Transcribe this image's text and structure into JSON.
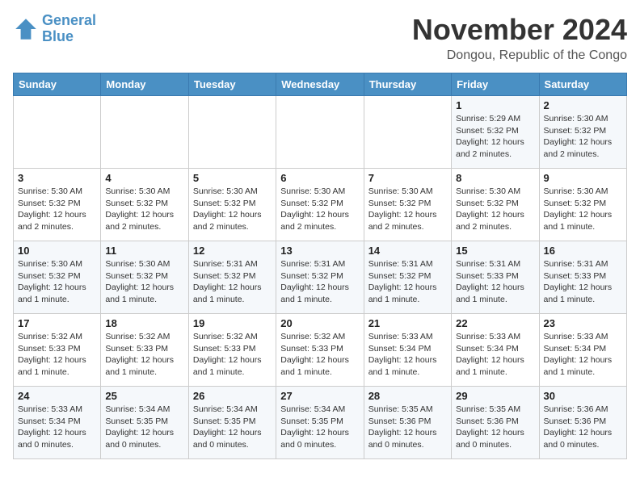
{
  "logo": {
    "line1": "General",
    "line2": "Blue"
  },
  "title": "November 2024",
  "location": "Dongou, Republic of the Congo",
  "days_header": [
    "Sunday",
    "Monday",
    "Tuesday",
    "Wednesday",
    "Thursday",
    "Friday",
    "Saturday"
  ],
  "weeks": [
    [
      {
        "day": "",
        "sunrise": "",
        "sunset": "",
        "daylight": ""
      },
      {
        "day": "",
        "sunrise": "",
        "sunset": "",
        "daylight": ""
      },
      {
        "day": "",
        "sunrise": "",
        "sunset": "",
        "daylight": ""
      },
      {
        "day": "",
        "sunrise": "",
        "sunset": "",
        "daylight": ""
      },
      {
        "day": "",
        "sunrise": "",
        "sunset": "",
        "daylight": ""
      },
      {
        "day": "1",
        "sunrise": "Sunrise: 5:29 AM",
        "sunset": "Sunset: 5:32 PM",
        "daylight": "Daylight: 12 hours and 2 minutes."
      },
      {
        "day": "2",
        "sunrise": "Sunrise: 5:30 AM",
        "sunset": "Sunset: 5:32 PM",
        "daylight": "Daylight: 12 hours and 2 minutes."
      }
    ],
    [
      {
        "day": "3",
        "sunrise": "Sunrise: 5:30 AM",
        "sunset": "Sunset: 5:32 PM",
        "daylight": "Daylight: 12 hours and 2 minutes."
      },
      {
        "day": "4",
        "sunrise": "Sunrise: 5:30 AM",
        "sunset": "Sunset: 5:32 PM",
        "daylight": "Daylight: 12 hours and 2 minutes."
      },
      {
        "day": "5",
        "sunrise": "Sunrise: 5:30 AM",
        "sunset": "Sunset: 5:32 PM",
        "daylight": "Daylight: 12 hours and 2 minutes."
      },
      {
        "day": "6",
        "sunrise": "Sunrise: 5:30 AM",
        "sunset": "Sunset: 5:32 PM",
        "daylight": "Daylight: 12 hours and 2 minutes."
      },
      {
        "day": "7",
        "sunrise": "Sunrise: 5:30 AM",
        "sunset": "Sunset: 5:32 PM",
        "daylight": "Daylight: 12 hours and 2 minutes."
      },
      {
        "day": "8",
        "sunrise": "Sunrise: 5:30 AM",
        "sunset": "Sunset: 5:32 PM",
        "daylight": "Daylight: 12 hours and 2 minutes."
      },
      {
        "day": "9",
        "sunrise": "Sunrise: 5:30 AM",
        "sunset": "Sunset: 5:32 PM",
        "daylight": "Daylight: 12 hours and 1 minute."
      }
    ],
    [
      {
        "day": "10",
        "sunrise": "Sunrise: 5:30 AM",
        "sunset": "Sunset: 5:32 PM",
        "daylight": "Daylight: 12 hours and 1 minute."
      },
      {
        "day": "11",
        "sunrise": "Sunrise: 5:30 AM",
        "sunset": "Sunset: 5:32 PM",
        "daylight": "Daylight: 12 hours and 1 minute."
      },
      {
        "day": "12",
        "sunrise": "Sunrise: 5:31 AM",
        "sunset": "Sunset: 5:32 PM",
        "daylight": "Daylight: 12 hours and 1 minute."
      },
      {
        "day": "13",
        "sunrise": "Sunrise: 5:31 AM",
        "sunset": "Sunset: 5:32 PM",
        "daylight": "Daylight: 12 hours and 1 minute."
      },
      {
        "day": "14",
        "sunrise": "Sunrise: 5:31 AM",
        "sunset": "Sunset: 5:32 PM",
        "daylight": "Daylight: 12 hours and 1 minute."
      },
      {
        "day": "15",
        "sunrise": "Sunrise: 5:31 AM",
        "sunset": "Sunset: 5:33 PM",
        "daylight": "Daylight: 12 hours and 1 minute."
      },
      {
        "day": "16",
        "sunrise": "Sunrise: 5:31 AM",
        "sunset": "Sunset: 5:33 PM",
        "daylight": "Daylight: 12 hours and 1 minute."
      }
    ],
    [
      {
        "day": "17",
        "sunrise": "Sunrise: 5:32 AM",
        "sunset": "Sunset: 5:33 PM",
        "daylight": "Daylight: 12 hours and 1 minute."
      },
      {
        "day": "18",
        "sunrise": "Sunrise: 5:32 AM",
        "sunset": "Sunset: 5:33 PM",
        "daylight": "Daylight: 12 hours and 1 minute."
      },
      {
        "day": "19",
        "sunrise": "Sunrise: 5:32 AM",
        "sunset": "Sunset: 5:33 PM",
        "daylight": "Daylight: 12 hours and 1 minute."
      },
      {
        "day": "20",
        "sunrise": "Sunrise: 5:32 AM",
        "sunset": "Sunset: 5:33 PM",
        "daylight": "Daylight: 12 hours and 1 minute."
      },
      {
        "day": "21",
        "sunrise": "Sunrise: 5:33 AM",
        "sunset": "Sunset: 5:34 PM",
        "daylight": "Daylight: 12 hours and 1 minute."
      },
      {
        "day": "22",
        "sunrise": "Sunrise: 5:33 AM",
        "sunset": "Sunset: 5:34 PM",
        "daylight": "Daylight: 12 hours and 1 minute."
      },
      {
        "day": "23",
        "sunrise": "Sunrise: 5:33 AM",
        "sunset": "Sunset: 5:34 PM",
        "daylight": "Daylight: 12 hours and 1 minute."
      }
    ],
    [
      {
        "day": "24",
        "sunrise": "Sunrise: 5:33 AM",
        "sunset": "Sunset: 5:34 PM",
        "daylight": "Daylight: 12 hours and 0 minutes."
      },
      {
        "day": "25",
        "sunrise": "Sunrise: 5:34 AM",
        "sunset": "Sunset: 5:35 PM",
        "daylight": "Daylight: 12 hours and 0 minutes."
      },
      {
        "day": "26",
        "sunrise": "Sunrise: 5:34 AM",
        "sunset": "Sunset: 5:35 PM",
        "daylight": "Daylight: 12 hours and 0 minutes."
      },
      {
        "day": "27",
        "sunrise": "Sunrise: 5:34 AM",
        "sunset": "Sunset: 5:35 PM",
        "daylight": "Daylight: 12 hours and 0 minutes."
      },
      {
        "day": "28",
        "sunrise": "Sunrise: 5:35 AM",
        "sunset": "Sunset: 5:36 PM",
        "daylight": "Daylight: 12 hours and 0 minutes."
      },
      {
        "day": "29",
        "sunrise": "Sunrise: 5:35 AM",
        "sunset": "Sunset: 5:36 PM",
        "daylight": "Daylight: 12 hours and 0 minutes."
      },
      {
        "day": "30",
        "sunrise": "Sunrise: 5:36 AM",
        "sunset": "Sunset: 5:36 PM",
        "daylight": "Daylight: 12 hours and 0 minutes."
      }
    ]
  ]
}
